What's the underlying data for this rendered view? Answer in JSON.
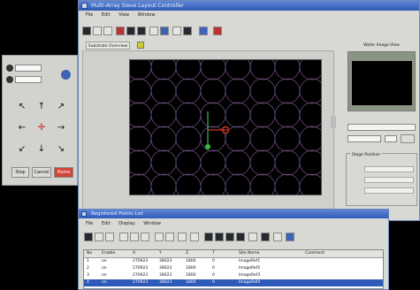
{
  "main_window": {
    "title": "Multi-Array Sieve Layout Controller",
    "menu": [
      "File",
      "Edit",
      "View",
      "Window"
    ],
    "tab_label": "Substrate Overview",
    "side": {
      "preview_label": "Wafer Image View",
      "position_label": "Stage Position"
    }
  },
  "jog_panel": {
    "buttons": [
      "Stop",
      "Cancel",
      "Home"
    ]
  },
  "list_window": {
    "title": "Registered Points List",
    "menu": [
      "File",
      "Edit",
      "Display",
      "Window"
    ],
    "columns": [
      "No",
      "Enable",
      "X",
      "Y",
      "Z",
      "T",
      "Site Name",
      "Comment"
    ],
    "rows": [
      {
        "no": "1",
        "enable": "on",
        "x": "270923",
        "y": "38023",
        "z": "1800",
        "t": "0",
        "site": "ImageRef1",
        "comment": ""
      },
      {
        "no": "2",
        "enable": "on",
        "x": "270923",
        "y": "38023",
        "z": "1800",
        "t": "0",
        "site": "ImageRef2",
        "comment": ""
      },
      {
        "no": "3",
        "enable": "on",
        "x": "270923",
        "y": "38023",
        "z": "1800",
        "t": "0",
        "site": "ImageRef3",
        "comment": ""
      },
      {
        "no": "4",
        "enable": "on",
        "x": "270923",
        "y": "38023",
        "z": "1800",
        "t": "0",
        "site": "ImageRef4",
        "comment": ""
      }
    ]
  },
  "colors": {
    "titlebar": "#2f5bb8",
    "circle_outline": "#6a4c7c",
    "axis_green": "#2fbf3f",
    "axis_red": "#d23a2a"
  }
}
